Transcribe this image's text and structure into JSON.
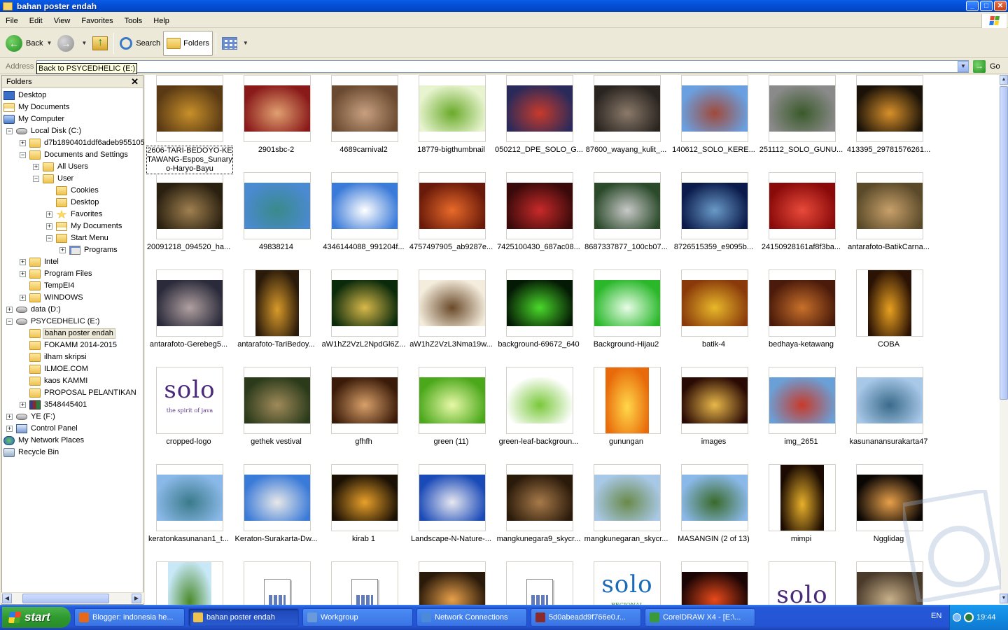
{
  "window": {
    "title": "bahan poster endah"
  },
  "menu": [
    "File",
    "Edit",
    "View",
    "Favorites",
    "Tools",
    "Help"
  ],
  "toolbar": {
    "back": "Back",
    "search": "Search",
    "folders": "Folders"
  },
  "address": {
    "label": "Address",
    "go": "Go",
    "tooltip": "Back to PSYCEDHELIC (E:)"
  },
  "folders_pane": {
    "title": "Folders",
    "close": "✕",
    "tree": [
      {
        "label": "Desktop",
        "icon": "desktop-icon",
        "level": 0,
        "expander": ""
      },
      {
        "label": "My Documents",
        "icon": "my-documents-icon",
        "level": 0,
        "expander": ""
      },
      {
        "label": "My Computer",
        "icon": "my-computer-icon",
        "level": 0,
        "expander": ""
      },
      {
        "label": "Local Disk (C:)",
        "icon": "drive-icon",
        "level": 1,
        "expander": "−"
      },
      {
        "label": "d7b1890401ddf6adeb955105",
        "icon": "folder-icon",
        "level": 2,
        "expander": "+"
      },
      {
        "label": "Documents and Settings",
        "icon": "folder-icon",
        "level": 2,
        "expander": "−"
      },
      {
        "label": "All Users",
        "icon": "folder-icon",
        "level": 3,
        "expander": "+"
      },
      {
        "label": "User",
        "icon": "folder-icon",
        "level": 3,
        "expander": "−"
      },
      {
        "label": "Cookies",
        "icon": "folder-icon",
        "level": 4,
        "expander": ""
      },
      {
        "label": "Desktop",
        "icon": "folder-icon",
        "level": 4,
        "expander": ""
      },
      {
        "label": "Favorites",
        "icon": "favorites-icon",
        "level": 4,
        "expander": "+"
      },
      {
        "label": "My Documents",
        "icon": "my-documents-icon",
        "level": 4,
        "expander": "+"
      },
      {
        "label": "Start Menu",
        "icon": "folder-icon",
        "level": 4,
        "expander": "−"
      },
      {
        "label": "Programs",
        "icon": "programs-icon",
        "level": 5,
        "expander": "+"
      },
      {
        "label": "Intel",
        "icon": "folder-icon",
        "level": 2,
        "expander": "+"
      },
      {
        "label": "Program Files",
        "icon": "folder-icon",
        "level": 2,
        "expander": "+"
      },
      {
        "label": "TempEI4",
        "icon": "folder-icon",
        "level": 2,
        "expander": ""
      },
      {
        "label": "WINDOWS",
        "icon": "folder-icon",
        "level": 2,
        "expander": "+"
      },
      {
        "label": "data (D:)",
        "icon": "drive-icon",
        "level": 1,
        "expander": "+"
      },
      {
        "label": "PSYCEDHELIC (E:)",
        "icon": "drive-icon",
        "level": 1,
        "expander": "−"
      },
      {
        "label": "bahan poster endah",
        "icon": "folder-icon",
        "level": 2,
        "expander": "",
        "selected": true
      },
      {
        "label": "FOKAMM 2014-2015",
        "icon": "folder-icon",
        "level": 2,
        "expander": ""
      },
      {
        "label": "ilham skripsi",
        "icon": "folder-icon",
        "level": 2,
        "expander": ""
      },
      {
        "label": "ILMOE.COM",
        "icon": "folder-icon",
        "level": 2,
        "expander": ""
      },
      {
        "label": "kaos KAMMI",
        "icon": "folder-icon",
        "level": 2,
        "expander": ""
      },
      {
        "label": "PROPOSAL PELANTIKAN",
        "icon": "folder-icon",
        "level": 2,
        "expander": ""
      },
      {
        "label": "3548445401",
        "icon": "rar-archive-icon",
        "level": 2,
        "expander": "+"
      },
      {
        "label": "YE (F:)",
        "icon": "drive-icon",
        "level": 1,
        "expander": "+"
      },
      {
        "label": "Control Panel",
        "icon": "control-panel-icon",
        "level": 1,
        "expander": "+"
      },
      {
        "label": "My Network Places",
        "icon": "network-places-icon",
        "level": 0,
        "expander": ""
      },
      {
        "label": "Recycle Bin",
        "icon": "recycle-bin-icon",
        "level": 0,
        "expander": ""
      }
    ]
  },
  "files": [
    {
      "name": "2606-TARI-BEDOYO-KETAWANG-Espos_Sunaryo-Haryo-Bayu",
      "selected": true,
      "colors": [
        "#5a3a14",
        "#c8902a"
      ]
    },
    {
      "name": "2901sbc-2",
      "colors": [
        "#8a1a1a",
        "#e0a070"
      ]
    },
    {
      "name": "4689carnival2",
      "colors": [
        "#6a4a30",
        "#c8a080"
      ]
    },
    {
      "name": "18779-bigthumbnail",
      "colors": [
        "#e8f4d0",
        "#6aaa2a"
      ]
    },
    {
      "name": "050212_DPE_SOLO_G...",
      "colors": [
        "#2a2a5a",
        "#c83a2a"
      ]
    },
    {
      "name": "87600_wayang_kulit_...",
      "colors": [
        "#2a2420",
        "#8a7a6a"
      ]
    },
    {
      "name": "140612_SOLO_KERE...",
      "colors": [
        "#6aa0e0",
        "#a04a3a"
      ]
    },
    {
      "name": "251112_SOLO_GUNU...",
      "colors": [
        "#8a8a8a",
        "#3a5a2a"
      ]
    },
    {
      "name": "413395_29781576261...",
      "colors": [
        "#1a1208",
        "#d8902a"
      ]
    },
    {
      "name": "20091218_094520_ha...",
      "colors": [
        "#2a2010",
        "#a08050"
      ]
    },
    {
      "name": "49838214",
      "colors": [
        "#4a8ad0",
        "#3a8a8a"
      ]
    },
    {
      "name": "4346144088_991204f...",
      "colors": [
        "#3a7ad8",
        "#ffffff"
      ]
    },
    {
      "name": "4757497905_ab9287e...",
      "colors": [
        "#6a1a0a",
        "#e86a2a"
      ]
    },
    {
      "name": "7425100430_687ac08...",
      "colors": [
        "#3a0a0a",
        "#c82a2a"
      ]
    },
    {
      "name": "8687337877_100cb07...",
      "colors": [
        "#2a4a2a",
        "#c8c8c8"
      ]
    },
    {
      "name": "8726515359_e9095b...",
      "colors": [
        "#0a1a4a",
        "#6a9ac8"
      ]
    },
    {
      "name": "24150928161af8f3ba...",
      "colors": [
        "#8a0a0a",
        "#e84a3a"
      ]
    },
    {
      "name": "antarafoto-BatikCarna...",
      "colors": [
        "#5a4a2a",
        "#c8a06a"
      ]
    },
    {
      "name": "antarafoto-Gerebeg5...",
      "colors": [
        "#2a2a3a",
        "#b0a0a0"
      ]
    },
    {
      "name": "antarafoto-TariBedoy...",
      "colors": [
        "#2a1a0a",
        "#d89a2a"
      ],
      "tall": true
    },
    {
      "name": "aW1hZ2VzL2NpdGl6Z...",
      "colors": [
        "#0a2a0a",
        "#d8b84a"
      ]
    },
    {
      "name": "aW1hZ2VzL3Nma19w...",
      "colors": [
        "#f4ecdc",
        "#6a4a2a"
      ]
    },
    {
      "name": "background-69672_640",
      "colors": [
        "#041a04",
        "#4ad82a"
      ]
    },
    {
      "name": "Background-Hijau2",
      "colors": [
        "#2ab82a",
        "#e8fce8"
      ]
    },
    {
      "name": "batik-4",
      "colors": [
        "#8a3a0a",
        "#e8b82a"
      ]
    },
    {
      "name": "bedhaya-ketawang",
      "colors": [
        "#4a1a0a",
        "#c8702a"
      ]
    },
    {
      "name": "COBA",
      "colors": [
        "#2a1204",
        "#e8a020"
      ],
      "tall": true
    },
    {
      "name": "cropped-logo",
      "logo": "solo",
      "colors": [
        "#ffffff",
        "#ffffff"
      ]
    },
    {
      "name": "gethek vestival",
      "colors": [
        "#2a3a1a",
        "#a08a5a"
      ]
    },
    {
      "name": "gfhfh",
      "colors": [
        "#3a1a08",
        "#d8a06a"
      ]
    },
    {
      "name": "green (11)",
      "colors": [
        "#4aa81a",
        "#e8f8a8"
      ]
    },
    {
      "name": "green-leaf-backgroun...",
      "colors": [
        "#ffffff",
        "#7ac83a"
      ]
    },
    {
      "name": "gunungan",
      "colors": [
        "#e86a0a",
        "#ffd84a"
      ],
      "tall": true
    },
    {
      "name": "images",
      "colors": [
        "#2a0a04",
        "#e8b84a"
      ]
    },
    {
      "name": "img_2651",
      "colors": [
        "#6aa0d8",
        "#c83a2a"
      ]
    },
    {
      "name": "kasunanansurakarta47",
      "colors": [
        "#a8c8e8",
        "#3a6a8a"
      ]
    },
    {
      "name": "keratonkasunanan1_t...",
      "colors": [
        "#8ab8e8",
        "#3a7a8a"
      ]
    },
    {
      "name": "Keraton-Surakarta-Dw...",
      "colors": [
        "#3a7ad8",
        "#e8e8e8"
      ]
    },
    {
      "name": "kirab 1",
      "colors": [
        "#1a1004",
        "#e8a02a"
      ]
    },
    {
      "name": "Landscape-N-Nature-...",
      "colors": [
        "#1a4ab8",
        "#e8e8f0"
      ]
    },
    {
      "name": "mangkunegara9_skycr...",
      "colors": [
        "#2a1a0a",
        "#a87a4a"
      ]
    },
    {
      "name": "mangkunegaran_skycr...",
      "colors": [
        "#a8c8e8",
        "#6a8a4a"
      ]
    },
    {
      "name": "MASANGIN (2 of 13)",
      "colors": [
        "#8ab8e8",
        "#3a6a2a"
      ]
    },
    {
      "name": "mimpi",
      "colors": [
        "#1a0a02",
        "#e8b02a"
      ],
      "tall": true
    },
    {
      "name": "Ngglidag",
      "colors": [
        "#0a0604",
        "#e8a04a"
      ]
    },
    {
      "name": "",
      "logo": "solo-small",
      "colors": [
        "#c8e8f8",
        "#4a8a2a"
      ],
      "tall": true
    },
    {
      "name": "",
      "doc": true,
      "colors": [
        "#ffffff",
        "#ffffff"
      ]
    },
    {
      "name": "",
      "doc": true,
      "colors": [
        "#ffffff",
        "#ffffff"
      ]
    },
    {
      "name": "",
      "colors": [
        "#2a1a0a",
        "#e8a04a"
      ]
    },
    {
      "name": "",
      "doc": true,
      "colors": [
        "#ffffff",
        "#ffffff"
      ]
    },
    {
      "name": "",
      "logo": "solo-regional",
      "colors": [
        "#ffffff",
        "#ffffff"
      ]
    },
    {
      "name": "",
      "colors": [
        "#1a0404",
        "#e84a1a"
      ]
    },
    {
      "name": "",
      "logo": "solo-plain",
      "colors": [
        "#ffffff",
        "#ffffff"
      ]
    },
    {
      "name": "",
      "colors": [
        "#4a3a2a",
        "#c8b08a"
      ]
    }
  ],
  "logo_text": {
    "solo": "solo",
    "spirit": "the spirit of java",
    "regional": "REGIONAL"
  },
  "taskbar": {
    "start": "start",
    "tasks": [
      {
        "label": "Blogger: indonesia he...",
        "icon": "firefox-icon",
        "color": "#e8681a"
      },
      {
        "label": "bahan poster endah",
        "icon": "folder-icon",
        "color": "#eec24f",
        "active": true
      },
      {
        "label": "Workgroup",
        "icon": "network-icon",
        "color": "#6a9ad8"
      },
      {
        "label": "Network Connections",
        "icon": "network-connections-icon",
        "color": "#4a8ad8"
      },
      {
        "label": "5d0abeadd9f766e0.r...",
        "icon": "rar-archive-icon",
        "color": "#8a2a2a"
      },
      {
        "label": "CorelDRAW X4 - [E:\\...",
        "icon": "coreldraw-icon",
        "color": "#3a9a3a"
      }
    ],
    "lang": "EN",
    "clock": "19:44"
  }
}
